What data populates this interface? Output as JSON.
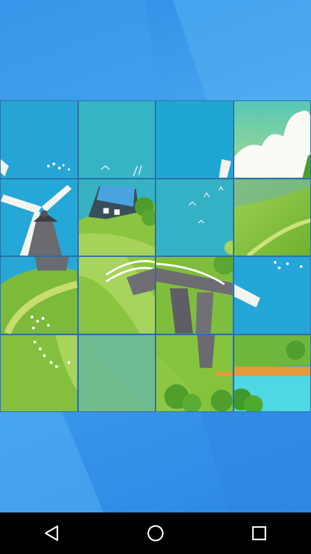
{
  "puzzle": {
    "grid": "4x4",
    "tiles": [
      {
        "row": 1,
        "col": 1,
        "scene": "sky-with-windmill-blade-edge"
      },
      {
        "row": 1,
        "col": 2,
        "scene": "sky-with-bird"
      },
      {
        "row": 1,
        "col": 3,
        "scene": "sky-with-blade-tip"
      },
      {
        "row": 1,
        "col": 4,
        "scene": "sky-with-clouds"
      },
      {
        "row": 2,
        "col": 1,
        "scene": "windmill-top"
      },
      {
        "row": 2,
        "col": 2,
        "scene": "cottage-on-hill"
      },
      {
        "row": 2,
        "col": 3,
        "scene": "sky-with-birds"
      },
      {
        "row": 2,
        "col": 4,
        "scene": "green-hill"
      },
      {
        "row": 3,
        "col": 1,
        "scene": "hill-with-path-and-flowers"
      },
      {
        "row": 3,
        "col": 2,
        "scene": "bridge-left"
      },
      {
        "row": 3,
        "col": 3,
        "scene": "bridge-right"
      },
      {
        "row": 3,
        "col": 4,
        "scene": "sky-with-blade"
      },
      {
        "row": 4,
        "col": 1,
        "scene": "grass-with-flowers"
      },
      {
        "row": 4,
        "col": 2,
        "scene": "hill-slope"
      },
      {
        "row": 4,
        "col": 3,
        "scene": "bridge-base-and-bushes"
      },
      {
        "row": 4,
        "col": 4,
        "scene": "river-and-bushes"
      }
    ]
  },
  "colors": {
    "sky": "#2aa9d4",
    "sky_light": "#46c0c0",
    "grass": "#8cc23c",
    "grass_dark": "#5ea22a",
    "background": "#3b98ec"
  },
  "nav": {
    "back_icon": "triangle-back-icon",
    "home_icon": "circle-home-icon",
    "recents_icon": "square-recents-icon"
  }
}
